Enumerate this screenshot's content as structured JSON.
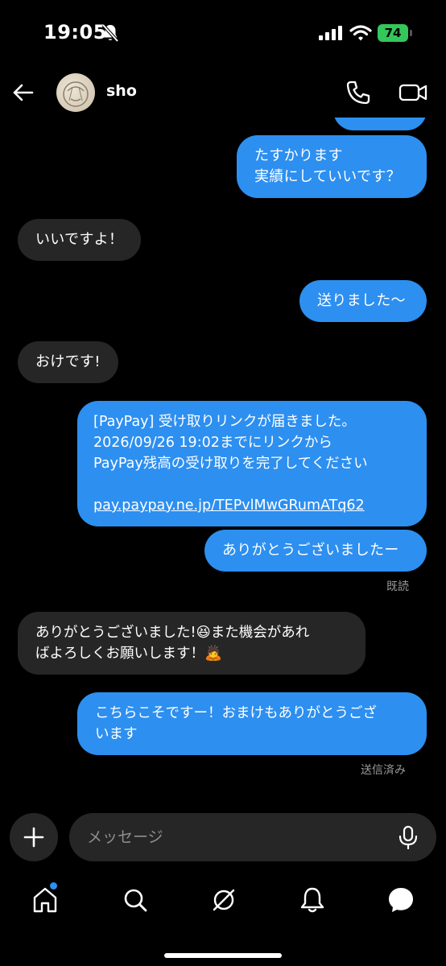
{
  "status_bar": {
    "time": "19:05",
    "battery": "74",
    "icons": [
      "bell-slash-icon",
      "signal-icon",
      "wifi-icon",
      "battery-icon"
    ]
  },
  "header": {
    "contact_name": "sho",
    "icons": [
      "back-arrow-icon",
      "avatar",
      "phone-icon",
      "video-camera-icon"
    ]
  },
  "messages": [
    {
      "dir": "out",
      "lines": [
        "たすかります",
        "実績にしていいです？"
      ]
    },
    {
      "dir": "in",
      "lines": [
        "いいですよ！"
      ]
    },
    {
      "dir": "out",
      "lines": [
        "送りました〜"
      ]
    },
    {
      "dir": "in",
      "lines": [
        "おけです!"
      ]
    },
    {
      "dir": "out",
      "lines": [
        "[PayPay] 受け取りリンクが届きました。",
        "2026/09/26 19:02までにリンクから",
        "PayPay残高の受け取りを完了してください",
        "",
        "pay.paypay.ne.jp/TEPvlMwGRumATq62"
      ]
    },
    {
      "dir": "out",
      "lines": [
        "ありがとうございましたー"
      ]
    },
    {
      "dir": "in",
      "lines": [
        "ありがとうございました!😆また機会があれ",
        "ばよろしくお願いします！🙇"
      ]
    },
    {
      "dir": "out",
      "lines": [
        "こちらこそですー！おまけもありがとうござ",
        "います"
      ]
    }
  ],
  "receipts": {
    "read": "既読",
    "sent": "送信済み"
  },
  "composer": {
    "placeholder": "メッセージ",
    "icons": [
      "plus-icon",
      "microphone-icon"
    ]
  },
  "tab_bar": {
    "icons": [
      "home-icon",
      "search-icon",
      "explore-icon",
      "bell-icon",
      "messenger-icon"
    ],
    "accent": "#2d8ff0"
  },
  "colors": {
    "outgoing_bubble": "#2d8ff0",
    "incoming_bubble": "#262626",
    "background": "#000000"
  }
}
